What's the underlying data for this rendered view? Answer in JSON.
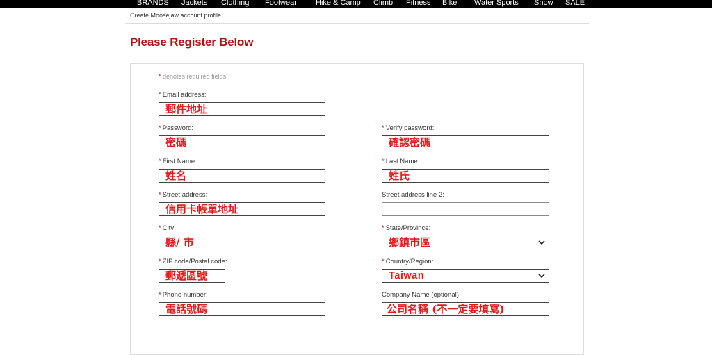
{
  "nav": {
    "items": [
      "BRANDS",
      "Jackets",
      "Clothing",
      "Footwear",
      "Hike & Camp",
      "Climb",
      "Fitness",
      "Bike",
      "Water Sports",
      "Snow",
      "SALE"
    ]
  },
  "page": {
    "subtitle": "Create Moosejaw account profile.",
    "heading": "Please Register Below",
    "required_note_star": "*",
    "required_note": " denotes required fields"
  },
  "form": {
    "email": {
      "label": "Email address:",
      "value": "郵件地址"
    },
    "password": {
      "label": "Password:",
      "value": "密碼"
    },
    "verify_password": {
      "label": "Verify password:",
      "value": "確認密碼"
    },
    "first_name": {
      "label": "First Name:",
      "value": "姓名"
    },
    "last_name": {
      "label": "Last Name:",
      "value": "姓氏"
    },
    "street": {
      "label": "Street address:",
      "value": "信用卡帳單地址"
    },
    "street2": {
      "label": "Street address line 2:",
      "value": ""
    },
    "city": {
      "label": "City:",
      "value": "縣/ 市"
    },
    "state": {
      "label": "State/Province:",
      "value": "鄉鎮市區"
    },
    "zip": {
      "label": "ZIP code/Postal code:",
      "value": "郵遞區號"
    },
    "country": {
      "label": "Country/Region:",
      "value": "Taiwan"
    },
    "phone": {
      "label": "Phone number:",
      "value": "電話號碼"
    },
    "company": {
      "label": "Company Name (optional)",
      "value": "公司名稱 (不一定要填寫)"
    }
  },
  "colors": {
    "brand_red": "#b50d12",
    "annotation_red": "#e21a1a",
    "nav_bg": "#000000"
  },
  "icons": {
    "select_arrow": "chevron-down-icon"
  }
}
